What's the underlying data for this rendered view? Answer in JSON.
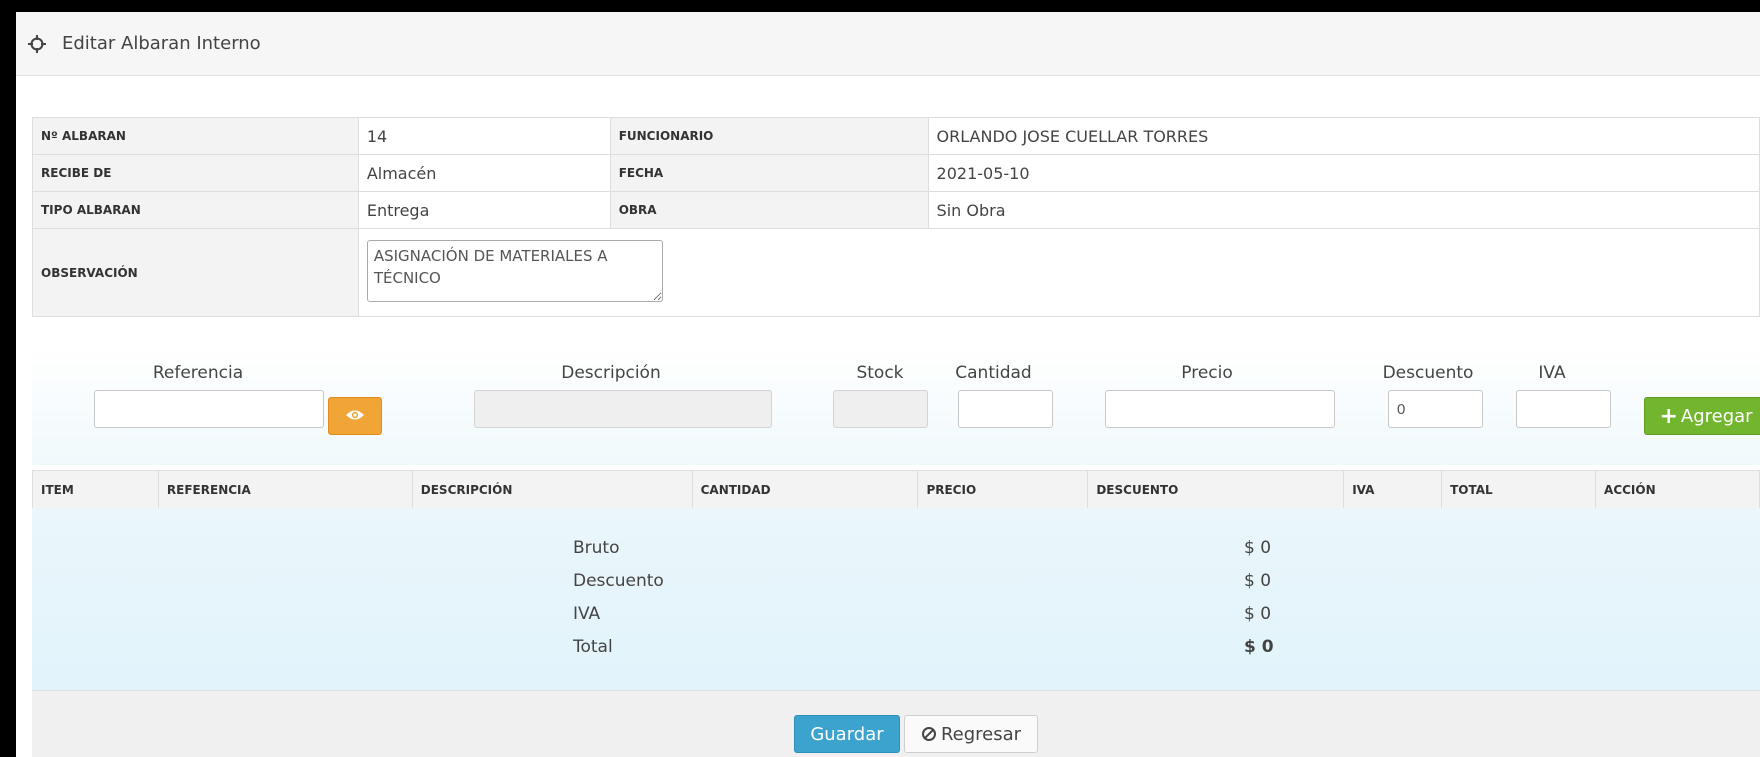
{
  "header": {
    "title": "Editar Albaran Interno",
    "icon": "crosshair-icon"
  },
  "info": {
    "albaran_label": "Nº ALBARAN",
    "albaran_value": "14",
    "funcionario_label": "FUNCIONARIO",
    "funcionario_value": "ORLANDO JOSE CUELLAR TORRES",
    "recibe_label": "RECIBE DE",
    "recibe_value": "Almacén",
    "fecha_label": "FECHA",
    "fecha_value": "2021-05-10",
    "tipo_label": "TIPO ALBARAN",
    "tipo_value": "Entrega",
    "obra_label": "OBRA",
    "obra_value": "Sin Obra",
    "observacion_label": "OBSERVACIÓN",
    "observacion_value": "ASIGNACIÓN DE MATERIALES A TÉCNICO"
  },
  "add_form": {
    "referencia_label": "Referencia",
    "referencia_value": "",
    "descripcion_label": "Descripción",
    "descripcion_value": "",
    "stock_label": "Stock",
    "stock_value": "",
    "cantidad_label": "Cantidad",
    "cantidad_value": "",
    "precio_label": "Precio",
    "precio_value": "",
    "descuento_label": "Descuento",
    "descuento_value": "0",
    "iva_label": "IVA",
    "iva_value": "",
    "add_button": "Agregar",
    "eye_icon": "eye-icon"
  },
  "grid": {
    "columns": [
      "ITEM",
      "REFERENCIA",
      "DESCRIPCIÓN",
      "CANTIDAD",
      "PRECIO",
      "DESCUENTO",
      "IVA",
      "TOTAL",
      "ACCIÓN"
    ]
  },
  "totals": [
    {
      "label": "Bruto",
      "value": "$ 0"
    },
    {
      "label": "Descuento",
      "value": "$ 0"
    },
    {
      "label": "IVA",
      "value": "$ 0"
    },
    {
      "label": "Total",
      "value": "$ 0"
    }
  ],
  "footer": {
    "save_label": "Guardar",
    "back_label": "Regresar"
  },
  "colors": {
    "save": "#3ca3cf",
    "add": "#72b52f",
    "eye": "#f0a536"
  }
}
